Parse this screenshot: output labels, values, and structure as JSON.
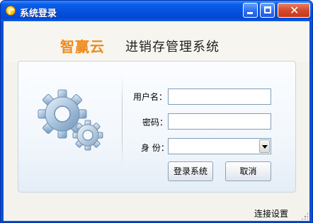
{
  "window": {
    "title": "系统登录"
  },
  "header": {
    "brand": "智赢云",
    "system_title": "进销存管理系统"
  },
  "form": {
    "username_label": "用户名：",
    "username_value": "",
    "password_label": "密码：",
    "password_value": "",
    "role_label": "身 份：",
    "role_selected": ""
  },
  "buttons": {
    "login_label": "登录系统",
    "cancel_label": "取消"
  },
  "footer": {
    "connection_settings_label": "连接设置"
  },
  "colors": {
    "titlebar": "#0550de",
    "brand_orange": "#f08a1c",
    "client_bg": "#f3f2ec"
  },
  "icons": [
    "app-icon",
    "minimize-icon",
    "maximize-icon",
    "close-icon",
    "gears-icon",
    "dropdown-arrow-icon"
  ]
}
